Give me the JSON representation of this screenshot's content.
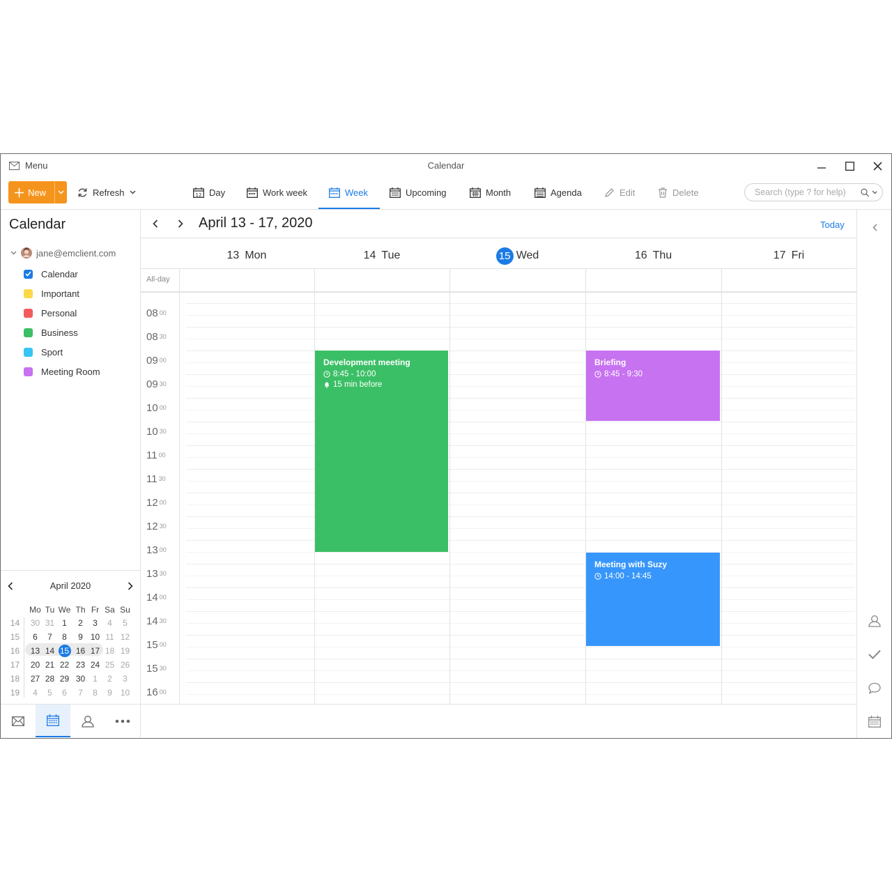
{
  "window": {
    "title": "Calendar",
    "menu_label": "Menu"
  },
  "toolbar": {
    "new_label": "New",
    "refresh_label": "Refresh",
    "views": [
      {
        "label": "Day",
        "icon": "calendar-day-icon"
      },
      {
        "label": "Work week",
        "icon": "calendar-workweek-icon"
      },
      {
        "label": "Week",
        "icon": "calendar-week-icon",
        "active": true
      },
      {
        "label": "Upcoming",
        "icon": "calendar-upcoming-icon"
      },
      {
        "label": "Month",
        "icon": "calendar-month-icon"
      },
      {
        "label": "Agenda",
        "icon": "calendar-agenda-icon"
      }
    ],
    "edit_label": "Edit",
    "delete_label": "Delete",
    "search_placeholder": "Search (type ? for help)"
  },
  "sidebar": {
    "title": "Calendar",
    "account": "jane@emclient.com",
    "calendars": [
      {
        "label": "Calendar",
        "color": "#1b7be6",
        "checked": true
      },
      {
        "label": "Important",
        "color": "#fbd84a"
      },
      {
        "label": "Personal",
        "color": "#f35c5c"
      },
      {
        "label": "Business",
        "color": "#3bbf66"
      },
      {
        "label": "Sport",
        "color": "#36c5f4"
      },
      {
        "label": "Meeting Room",
        "color": "#c772f0"
      }
    ]
  },
  "mini_calendar": {
    "month_label": "April 2020",
    "weekday_headers": [
      "Mo",
      "Tu",
      "We",
      "Th",
      "Fr",
      "Sa",
      "Su"
    ],
    "weeks": [
      {
        "num": "14",
        "days": [
          "30",
          "31",
          "1",
          "2",
          "3",
          "4",
          "5"
        ]
      },
      {
        "num": "15",
        "days": [
          "6",
          "7",
          "8",
          "9",
          "10",
          "11",
          "12"
        ]
      },
      {
        "num": "16",
        "days": [
          "13",
          "14",
          "15",
          "16",
          "17",
          "18",
          "19"
        ]
      },
      {
        "num": "17",
        "days": [
          "20",
          "21",
          "22",
          "23",
          "24",
          "25",
          "26"
        ]
      },
      {
        "num": "18",
        "days": [
          "27",
          "28",
          "29",
          "30",
          "1",
          "2",
          "3"
        ]
      },
      {
        "num": "19",
        "days": [
          "4",
          "5",
          "6",
          "7",
          "8",
          "9",
          "10"
        ]
      }
    ],
    "today": "15"
  },
  "nav": [
    {
      "name": "mail-icon"
    },
    {
      "name": "calendar-icon",
      "active": true
    },
    {
      "name": "contacts-icon"
    },
    {
      "name": "more-icon"
    }
  ],
  "calendar": {
    "range_title": "April 13 - 17, 2020",
    "today_label": "Today",
    "allday_label": "All-day",
    "days": [
      {
        "num": "13",
        "name": "Mon"
      },
      {
        "num": "14",
        "name": "Tue"
      },
      {
        "num": "15",
        "name": "Wed",
        "today": true
      },
      {
        "num": "16",
        "name": "Thu"
      },
      {
        "num": "17",
        "name": "Fri"
      }
    ],
    "time_slots": [
      {
        "h": "08",
        "m": "00"
      },
      {
        "h": "08",
        "m": "30"
      },
      {
        "h": "09",
        "m": "00"
      },
      {
        "h": "09",
        "m": "30"
      },
      {
        "h": "10",
        "m": "00"
      },
      {
        "h": "10",
        "m": "30"
      },
      {
        "h": "11",
        "m": "00"
      },
      {
        "h": "11",
        "m": "30"
      },
      {
        "h": "12",
        "m": "00"
      },
      {
        "h": "12",
        "m": "30"
      },
      {
        "h": "13",
        "m": "00"
      },
      {
        "h": "13",
        "m": "30"
      },
      {
        "h": "14",
        "m": "00"
      },
      {
        "h": "14",
        "m": "30"
      },
      {
        "h": "15",
        "m": "00"
      },
      {
        "h": "15",
        "m": "30"
      },
      {
        "h": "16",
        "m": "00"
      }
    ],
    "events": [
      {
        "title": "Development meeting",
        "time": "8:45 - 10:00",
        "reminder": "15 min before",
        "color": "#3bbf66"
      },
      {
        "title": "Briefing",
        "time": "8:45 - 9:30",
        "color": "#c772f0"
      },
      {
        "title": "Meeting with Suzy",
        "time": "14:00 - 14:45",
        "color": "#3796fb"
      }
    ]
  },
  "right_bar": [
    "collapse-arrow-icon",
    "contact-icon",
    "tasks-check-icon",
    "chat-icon",
    "calendar-small-icon"
  ]
}
